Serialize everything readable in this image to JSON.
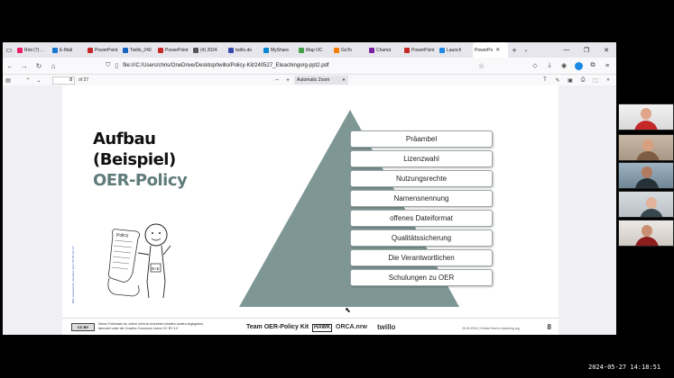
{
  "browser": {
    "tabs": [
      {
        "label": "Riot (7) ...",
        "color": "#e91e63"
      },
      {
        "label": "E-Mail",
        "color": "#1976d2"
      },
      {
        "label": "PowerPoint",
        "color": "#c62828"
      },
      {
        "label": "Twillo_240",
        "color": "#1565c0"
      },
      {
        "label": "PowerPoint",
        "color": "#c62828"
      },
      {
        "label": "(4) 2024",
        "color": "#555555"
      },
      {
        "label": "twillo.de",
        "color": "#3949ab"
      },
      {
        "label": "MyShare",
        "color": "#0288d1"
      },
      {
        "label": "Map OC",
        "color": "#43a047"
      },
      {
        "label": "GoTo",
        "color": "#f57c00"
      },
      {
        "label": "Chamä",
        "color": "#7b1fa2"
      },
      {
        "label": "PowerPoint",
        "color": "#c62828"
      },
      {
        "label": "Launch",
        "color": "#1e88e5"
      }
    ],
    "active_tab": "PowerPo",
    "url": "file:///C:/Users/chris/OneDrive/Desktop/twillo/Policy-Kit/240527_Eteachingorg-ppt2.pdf",
    "page_current": "8",
    "page_total": "of 27",
    "zoom": "Automatic Zoom"
  },
  "slide": {
    "title_line1": "Aufbau",
    "title_line2": "(Beispiel)",
    "title_line3": "OER-Policy",
    "side_credit": "Bild: weeseeit.de, lizenziert unter CC BY-SA 4.0",
    "pyramid_color": "#7e9795",
    "levels": [
      "Präambel",
      "Lizenzwahl",
      "Nutzungsrechte",
      "Namensnennung",
      "offenes Dateiformat",
      "Qualitätssicherung",
      "Die Verantwortlichen",
      "Schulungen zu OER"
    ],
    "illustration": {
      "policy_text": "Policy",
      "badge_text": "B+E"
    }
  },
  "footer": {
    "cc_badge": "CC BY",
    "license_line1": "Dieser Foliensatz ist, sofern nicht an einzelnen Inhalten anders angegeben,",
    "license_line2": "lizenziert unter der Creative Commons Lizenz CC BY 4.0",
    "team": "Team OER-Policy Kit",
    "hawk": "HAWK",
    "orca": "ORCA.nrw",
    "twillo": "twillo",
    "date_note": "25.05.2024 | Online Event e-teaching.org",
    "page_number": "8"
  },
  "timestamp": "2024-05-27 14:18:51"
}
